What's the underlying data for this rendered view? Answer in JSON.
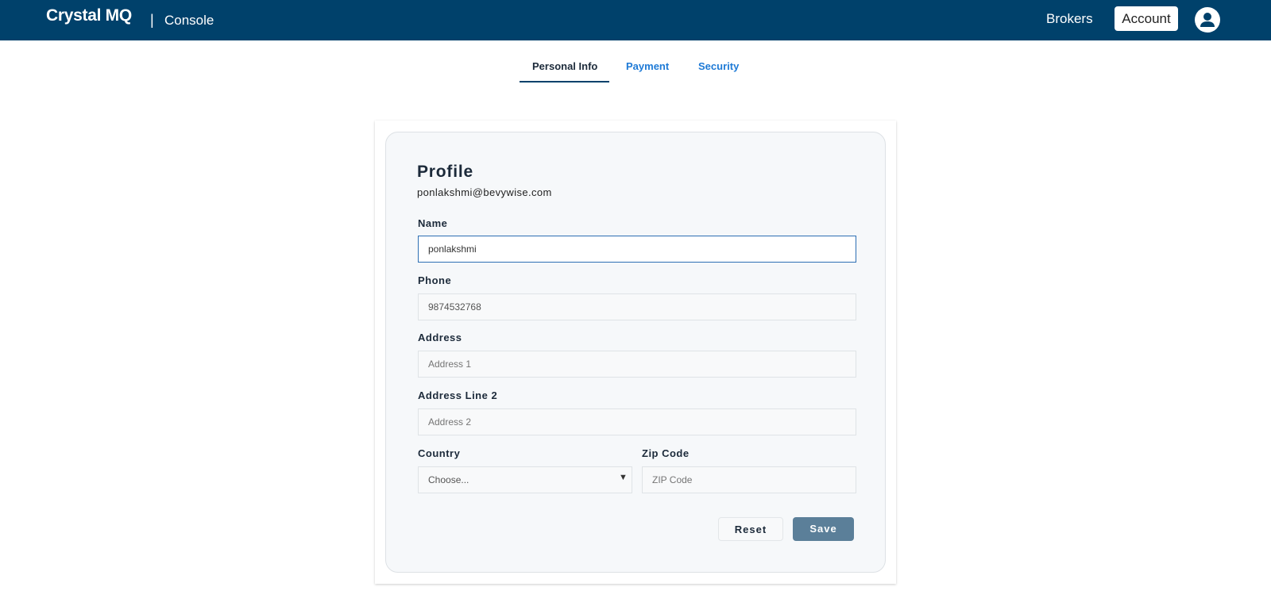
{
  "header": {
    "logo": "Crystal MQ",
    "separator": "|",
    "app_name": "Console",
    "brokers": "Brokers",
    "account": "Account",
    "avatar_icon": "user-circle-icon"
  },
  "tabs": [
    {
      "label": "Personal Info",
      "active": true
    },
    {
      "label": "Payment"
    },
    {
      "label": "Security"
    }
  ],
  "profile": {
    "title": "Profile",
    "email": "ponlakshmi@bevywise.com",
    "name_label": "Name",
    "name_value": "ponlakshmi",
    "phone_label": "Phone",
    "phone_value": "9874532768",
    "address_label": "Address",
    "address_placeholder": "Address 1",
    "address2_label": "Address Line 2",
    "address2_placeholder": "Address 2",
    "country_label": "Country",
    "country_value": "Choose...",
    "zip_label": "Zip Code",
    "zip_placeholder": "ZIP Code",
    "reset": "Reset",
    "save": "Save"
  },
  "colors": {
    "header_bg": "#00416b",
    "accent": "#1e7ad6",
    "save_bg": "#5b7f99"
  }
}
